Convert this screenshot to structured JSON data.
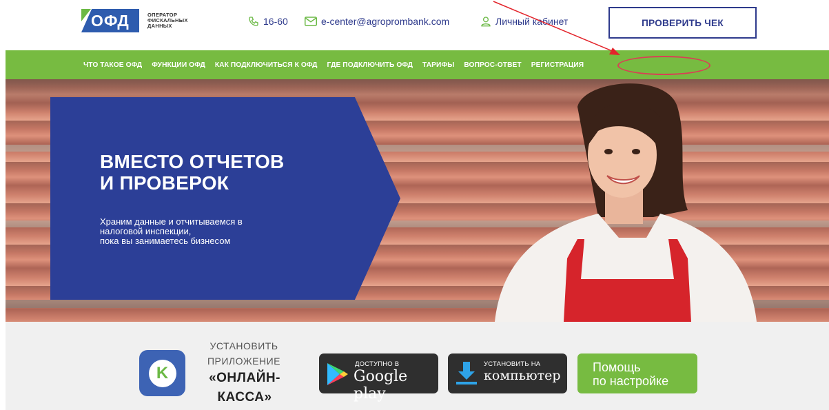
{
  "header": {
    "logo_text": "ОФД",
    "logo_sub": "ОПЕРАТОР ФИСКАЛЬНЫХ ДАННЫХ",
    "phone": "16-60",
    "email": "e-center@agroprombank.com",
    "cabinet": "Личный кабинет",
    "check_button": "ПРОВЕРИТЬ ЧЕК"
  },
  "nav": {
    "items": [
      {
        "label": "ЧТО ТАКОЕ ОФД"
      },
      {
        "label": "ФУНКЦИИ ОФД"
      },
      {
        "label": "КАК ПОДКЛЮЧИТЬСЯ К ОФД"
      },
      {
        "label": "ГДЕ ПОДКЛЮЧИТЬ ОФД"
      },
      {
        "label": "ТАРИФЫ"
      },
      {
        "label": "ВОПРОС-ОТВЕТ"
      },
      {
        "label": "РЕГИСТРАЦИЯ"
      }
    ]
  },
  "hero": {
    "title_line1": "ВМЕСТО ОТЧЕТОВ",
    "title_line2": "И ПРОВЕРОК",
    "text_line1": "Храним данные и отчитываемся в",
    "text_line2": "налоговой инспекции,",
    "text_line3": "пока вы занимаетесь бизнесом"
  },
  "app": {
    "install_line1": "УСТАНОВИТЬ",
    "install_line2": "ПРИЛОЖЕНИЕ",
    "name_line1": "«ОНЛАЙН-",
    "name_line2": "КАССА»",
    "icon_letter": "K",
    "google_small": "ДОСТУПНО В",
    "google_big": "Google play",
    "pc_small": "УСТАНОВИТЬ НА",
    "pc_big": "компьютер",
    "help_line1": "Помощь",
    "help_line2": "по настройке"
  },
  "colors": {
    "brand_blue": "#2c3f97",
    "nav_green": "#77bb41",
    "annotation_red": "#d94055"
  }
}
